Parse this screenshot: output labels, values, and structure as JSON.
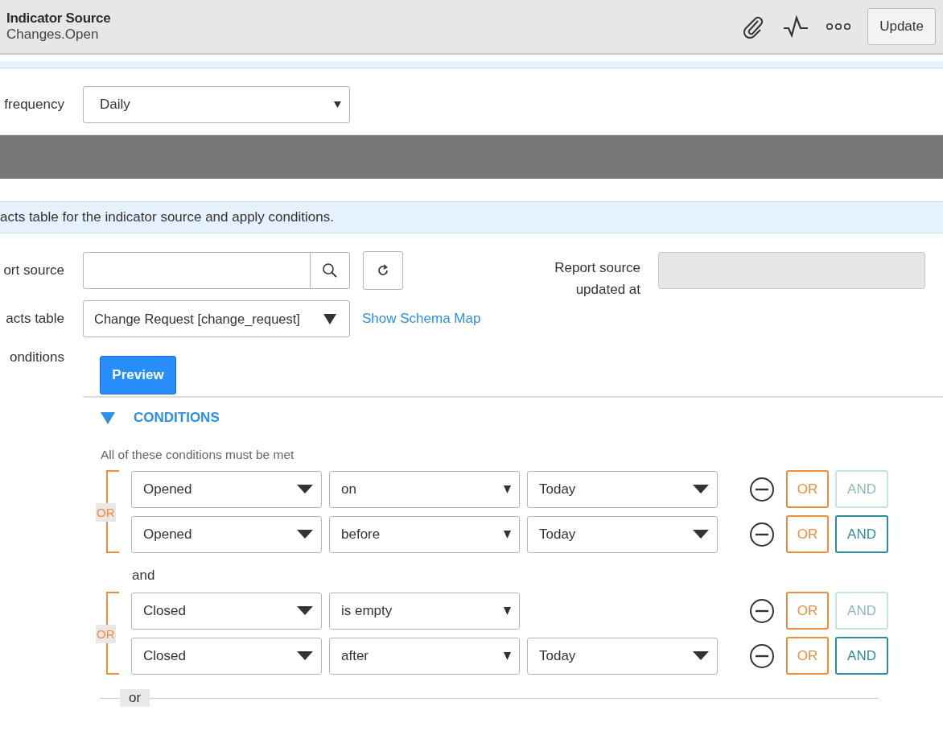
{
  "header": {
    "title": "Indicator Source",
    "subtitle": "Changes.Open",
    "update_button": "Update"
  },
  "frequency": {
    "label": "frequency",
    "value": "Daily"
  },
  "info_message": "acts table for the indicator source and apply conditions.",
  "report_source": {
    "label": "ort source",
    "updated_label": "Report source updated at"
  },
  "facts_table": {
    "label": "acts table",
    "value": "Change Request [change_request]",
    "link": "Show Schema Map"
  },
  "conditions_label": "onditions",
  "preview_button": "Preview",
  "conditions": {
    "title": "CONDITIONS",
    "expanded": true,
    "subtitle": "All of these conditions must be met",
    "groups": [
      {
        "label": "OR",
        "rows": [
          {
            "field": "Opened",
            "operator": "on",
            "value": "Today",
            "or": "OR",
            "and": "AND",
            "and_disabled": true
          },
          {
            "field": "Opened",
            "operator": "before",
            "value": "Today",
            "or": "OR",
            "and": "AND",
            "and_disabled": false
          }
        ]
      },
      {
        "joiner": "and",
        "label": "OR",
        "rows": [
          {
            "field": "Closed",
            "operator": "is empty",
            "or": "OR",
            "and": "AND",
            "and_disabled": true
          },
          {
            "field": "Closed",
            "operator": "after",
            "value": "Today",
            "or": "OR",
            "and": "AND",
            "and_disabled": false
          }
        ]
      }
    ],
    "or_label": "or"
  }
}
